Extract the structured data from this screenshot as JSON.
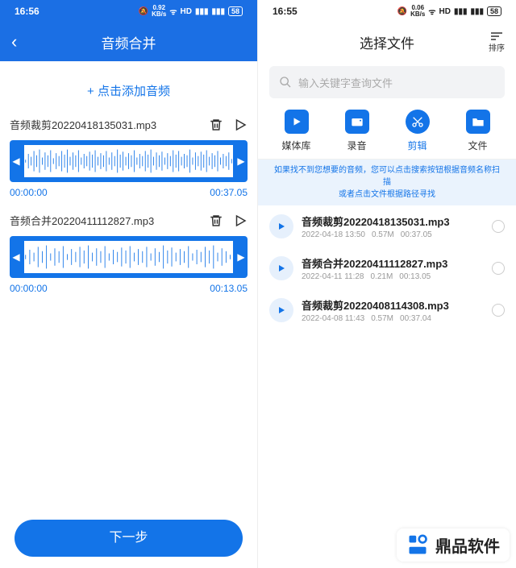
{
  "left": {
    "status": {
      "time": "16:56",
      "net": "0.92",
      "netUnit": "KB/s",
      "battery": "58"
    },
    "title": "音频合并",
    "addLabel": "+ 点击添加音频",
    "tracks": [
      {
        "name": "音频裁剪20220418135031.mp3",
        "start": "00:00:00",
        "end": "00:37.05"
      },
      {
        "name": "音频合并20220411112827.mp3",
        "start": "00:00:00",
        "end": "00:13.05"
      }
    ],
    "nextLabel": "下一步"
  },
  "right": {
    "status": {
      "time": "16:55",
      "net": "0.06",
      "netUnit": "KB/s",
      "battery": "58"
    },
    "title": "选择文件",
    "sortLabel": "排序",
    "searchPlaceholder": "输入关键字查询文件",
    "tabs": [
      {
        "label": "媒体库"
      },
      {
        "label": "录音"
      },
      {
        "label": "剪辑"
      },
      {
        "label": "文件"
      }
    ],
    "hint1": "如果找不到您想要的音频，您可以点击搜索按钮根据音频名称扫描",
    "hint2": "或者点击文件根据路径寻找",
    "files": [
      {
        "name": "音频裁剪20220418135031.mp3",
        "date": "2022-04-18 13:50",
        "size": "0.57M",
        "dur": "00:37.05"
      },
      {
        "name": "音频合并20220411112827.mp3",
        "date": "2022-04-11 11:28",
        "size": "0.21M",
        "dur": "00:13.05"
      },
      {
        "name": "音频裁剪20220408114308.mp3",
        "date": "2022-04-08 11:43",
        "size": "0.57M",
        "dur": "00:37.04"
      }
    ]
  },
  "brand": "鼎品软件"
}
